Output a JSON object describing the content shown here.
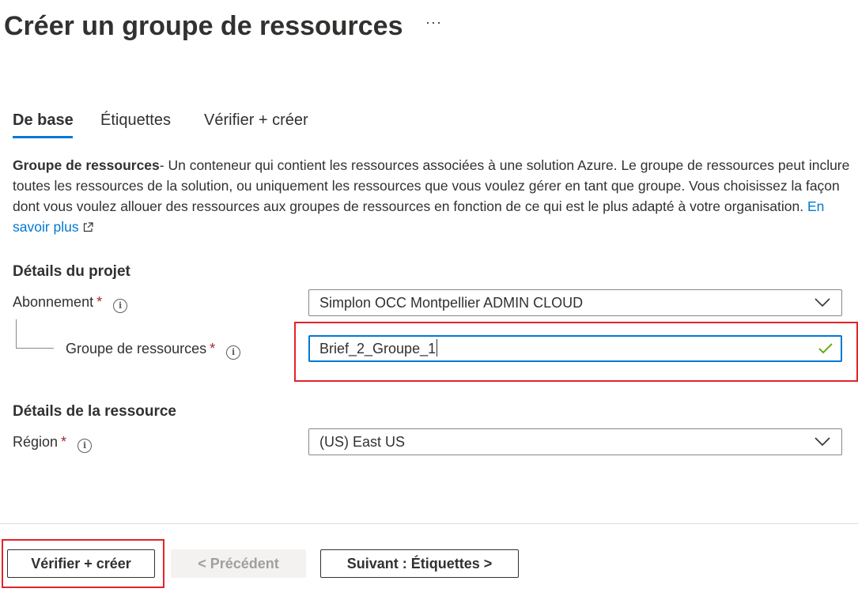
{
  "header": {
    "title": "Créer un groupe de ressources",
    "more_label": "···"
  },
  "tabs": [
    {
      "label": "De base",
      "active": true
    },
    {
      "label": "Étiquettes",
      "active": false
    },
    {
      "label": "Vérifier + créer",
      "active": false
    }
  ],
  "description": {
    "bold_term": "Groupe de ressources",
    "text": "- Un conteneur qui contient les ressources associées à une solution Azure. Le groupe de ressources peut inclure toutes les ressources de la solution, ou uniquement les ressources que vous voulez gérer en tant que groupe. Vous choisissez la façon dont vous voulez allouer des ressources aux groupes de ressources en fonction de ce qui est le plus adapté à votre organisation.",
    "link_label": "En savoir plus",
    "link_icon": "external-link-icon"
  },
  "project_details": {
    "heading": "Détails du projet",
    "subscription": {
      "label": "Abonnement",
      "required_mark": "*",
      "value": "Simplon OCC Montpellier ADMIN CLOUD"
    },
    "resource_group": {
      "label": "Groupe de ressources",
      "required_mark": "*",
      "value": "Brief_2_Groupe_1",
      "valid": true
    }
  },
  "resource_details": {
    "heading": "Détails de la ressource",
    "region": {
      "label": "Région",
      "required_mark": "*",
      "value": "(US) East US"
    }
  },
  "footer": {
    "review_create_label": "Vérifier + créer",
    "previous_label": "< Précédent",
    "next_label": "Suivant : Étiquettes >"
  },
  "colors": {
    "accent": "#0078d4",
    "highlight_box": "#e3232b",
    "required": "#a4262c",
    "valid_check": "#57a300"
  }
}
